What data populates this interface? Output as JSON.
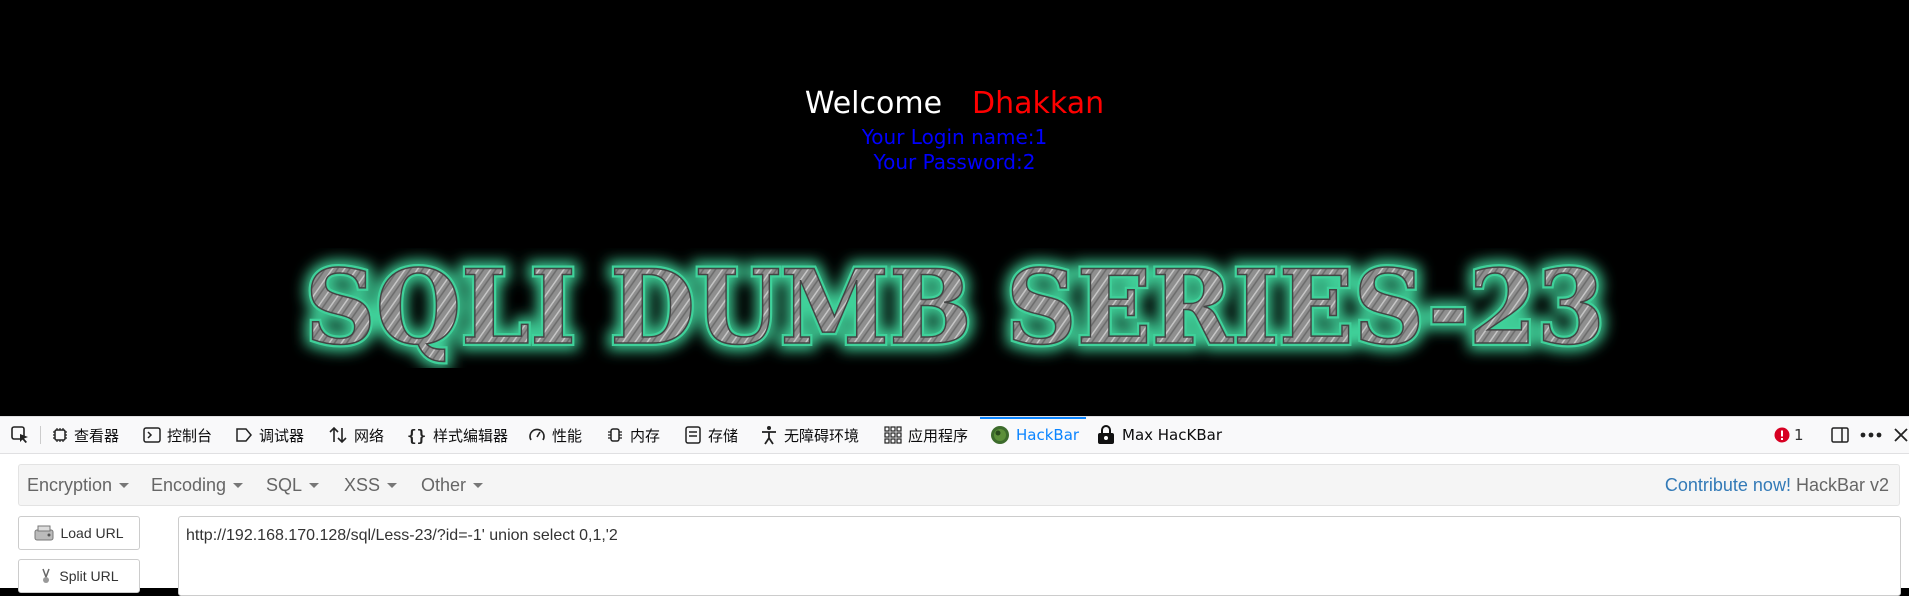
{
  "page": {
    "welcome": "Welcome",
    "user": "Dhakkan",
    "login_name": "Your Login name:1",
    "password": "Your Password:2",
    "banner_title": "SQLI DUMB SERIES-23"
  },
  "devtools": {
    "tabs": [
      {
        "label": "查看器",
        "icon": "inspector-icon"
      },
      {
        "label": "控制台",
        "icon": "console-icon"
      },
      {
        "label": "调试器",
        "icon": "debugger-icon"
      },
      {
        "label": "网络",
        "icon": "network-icon"
      },
      {
        "label": "样式编辑器",
        "icon": "style-editor-icon"
      },
      {
        "label": "性能",
        "icon": "performance-icon"
      },
      {
        "label": "内存",
        "icon": "memory-icon"
      },
      {
        "label": "存储",
        "icon": "storage-icon"
      },
      {
        "label": "无障碍环境",
        "icon": "accessibility-icon"
      },
      {
        "label": "应用程序",
        "icon": "application-icon"
      },
      {
        "label": "HackBar",
        "icon": "hackbar-icon",
        "active": true
      },
      {
        "label": "Max HacKBar",
        "icon": "max-hackbar-icon"
      }
    ],
    "error_count": "1",
    "colors": {
      "active": "#0a84ff",
      "error": "#d70022"
    }
  },
  "hackbar": {
    "menus": [
      "Encryption",
      "Encoding",
      "SQL",
      "XSS",
      "Other"
    ],
    "contribute": "Contribute now!",
    "version": "HackBar v2",
    "load_url": "Load URL",
    "split_url": "Split URL",
    "url": "http://192.168.170.128/sql/Less-23/?id=-1' union select 0,1,'2"
  },
  "colors": {
    "welcome": "#ffffff",
    "user": "#ff0000",
    "login": "#0000ff",
    "banner_glow": "#3fd19a",
    "link": "#337ab7"
  }
}
